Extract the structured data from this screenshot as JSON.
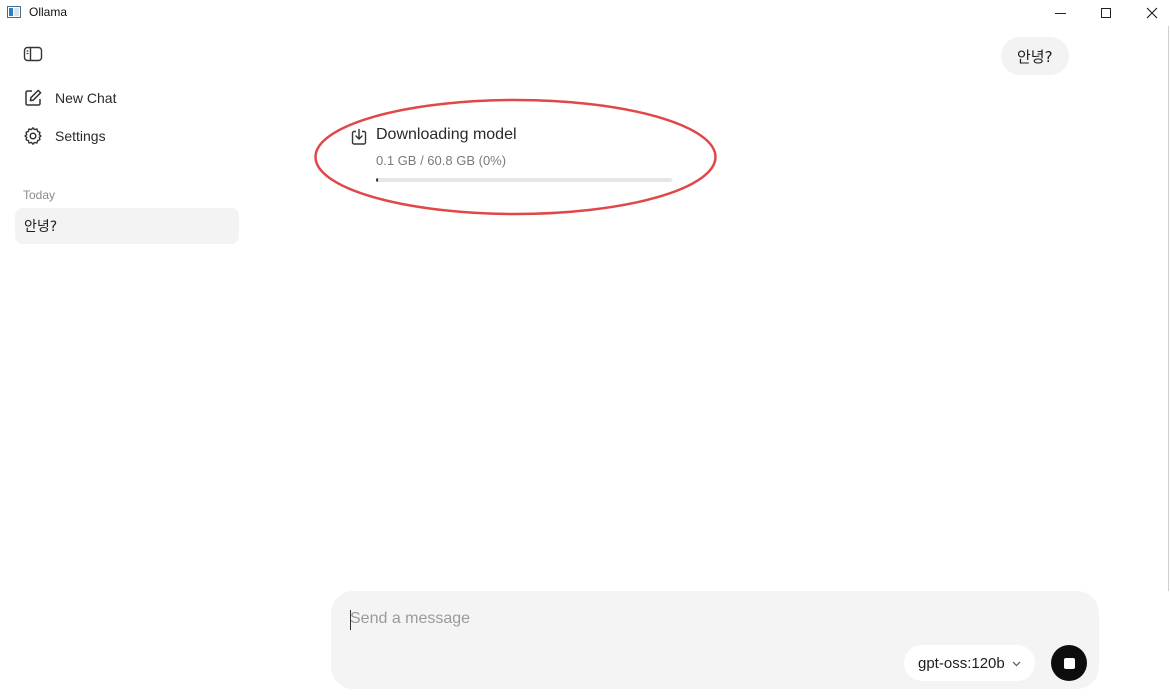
{
  "window": {
    "title": "Ollama",
    "icons": {
      "app": "ollama-app-icon",
      "minimize": "minimize-icon",
      "maximize": "maximize-icon",
      "close": "close-icon"
    }
  },
  "sidebar": {
    "toggle_icon": "sidebar-toggle-icon",
    "nav": [
      {
        "label": "New Chat",
        "icon": "compose-icon"
      },
      {
        "label": "Settings",
        "icon": "gear-icon"
      }
    ],
    "section_label": "Today",
    "history": [
      {
        "title": "안녕?"
      }
    ]
  },
  "chat": {
    "user_message": "안녕?",
    "download": {
      "icon": "download-icon",
      "title": "Downloading model",
      "progress_text": "0.1 GB / 60.8 GB (0%)",
      "progress_fraction": 0.0016
    },
    "annotation": {
      "shape": "ellipse",
      "color": "#e04848"
    }
  },
  "composer": {
    "placeholder": "Send a message",
    "value": "",
    "model": "gpt-oss:120b",
    "model_icon": "chevron-down-icon",
    "stop_icon": "stop-icon"
  },
  "colors": {
    "bubble_bg": "#f3f3f3",
    "composer_bg": "#f4f4f4",
    "annotation": "#e04848",
    "stop_button": "#0d0d0d"
  }
}
